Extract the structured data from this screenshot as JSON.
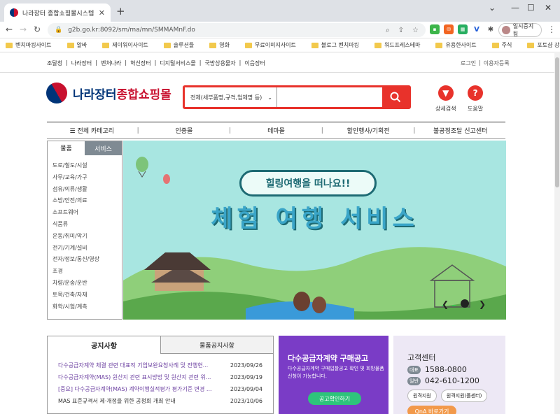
{
  "browser": {
    "tab_title": "나라장터 종합쇼핑몰시스템",
    "url": "g2b.go.kr:8092/sm/ma/mn/SMMAMnF.do",
    "profile_label": "일시중지됨",
    "bookmarks": [
      "벤치마킹사이트",
      "알바",
      "제이워이사이트",
      "솔루션들",
      "영화",
      "무료이미지사이트",
      "블로그 벤치마킹",
      "워드프레스테마",
      "유용한사이트",
      "주식",
      "포토샵 강좌"
    ]
  },
  "util": {
    "left_links": [
      "조달청",
      "나라장터",
      "벤처나라",
      "혁신장터",
      "디지털서비스몰",
      "국방상용물자",
      "이음장터"
    ],
    "right_links": [
      "로그인",
      "이용자등록"
    ]
  },
  "logo": {
    "part1": "나라장터",
    "part2": "종합쇼핑몰"
  },
  "search": {
    "scope": "전체(세부품명,규격,업체명 등)",
    "value": ""
  },
  "quick": {
    "detail_search": "상세검색",
    "help": "도움말"
  },
  "gnb": {
    "items": [
      "전체 카테고리",
      "인증몰",
      "테마몰",
      "할인행사/기획전",
      "불공정조달 신고센터"
    ]
  },
  "category": {
    "tabs": [
      "물품",
      "서비스"
    ],
    "items": [
      "도로/철도/시설",
      "사무/교육/가구",
      "섬유/의류/생활",
      "소방/안전/의료",
      "소프트웨어",
      "식품류",
      "운동/취미/악기",
      "전기/기계/설비",
      "전자/정보/통신/영상",
      "조경",
      "차량/운송/운반",
      "토목/건축/자재",
      "화학/시험/계측"
    ]
  },
  "banner": {
    "subtitle": "힐링여행을 떠나요!!",
    "title": "체험 여행 서비스"
  },
  "notice": {
    "tabs": [
      "공지사항",
      "물품공지사항"
    ],
    "rows": [
      {
        "title": "다수공급자계약 체결 관련 대표적 기업보완요청사례 및 전행현...",
        "date": "2023/09/26"
      },
      {
        "title": "다수공급자계약(MAS) 원산지 관련 표시방법 및 원산지 관련 위...",
        "date": "2023/09/19"
      },
      {
        "title": "[중요] 다수공급자계약(MAS) 계약이행실적평가 평가기준 변경 ...",
        "date": "2023/09/04"
      },
      {
        "title": "MAS 표준규격서 제·개정을 위한 공청회 개최 안내",
        "date": "2023/10/06"
      }
    ]
  },
  "promo": {
    "title": "다수공급자계약 구매공고",
    "desc": "다수공급자계약 구매입찰공고 확인 및 회망물품 신청이 가능합니다.",
    "button": "공고확인하기"
  },
  "cs": {
    "title": "고객센터",
    "phones": [
      {
        "label": "대표",
        "number": "1588-0800"
      },
      {
        "label": "일반",
        "number": "042-610-1200"
      }
    ],
    "buttons": [
      "원격지원",
      "원격지원(폴센터)"
    ],
    "qna": "QnA 바로가기"
  }
}
